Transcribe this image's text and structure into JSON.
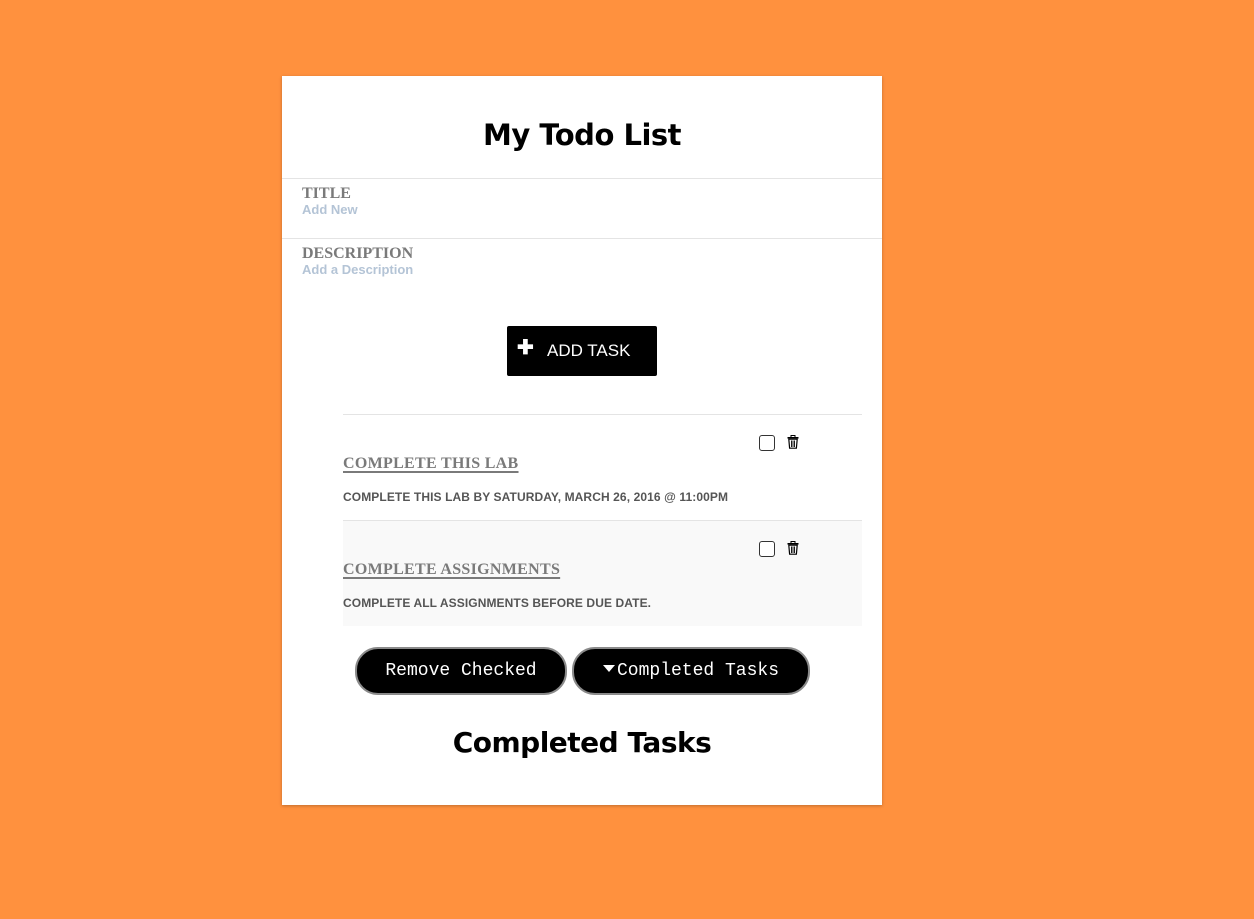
{
  "app": {
    "title": "My Todo List"
  },
  "form": {
    "title_label": "TITLE",
    "title_placeholder": "Add New",
    "description_label": "DESCRIPTION",
    "description_placeholder": "Add a Description",
    "add_button_label": "ADD TASK",
    "add_icon": "plus-icon"
  },
  "tasks": [
    {
      "title": "COMPLETE THIS LAB",
      "description": "COMPLETE THIS LAB BY SATURDAY, MARCH 26, 2016 @ 11:00PM",
      "checked": false
    },
    {
      "title": "COMPLETE ASSIGNMENTS",
      "description": "COMPLETE ALL ASSIGNMENTS BEFORE DUE DATE.",
      "checked": false
    }
  ],
  "actions": {
    "remove_checked_label": "Remove Checked",
    "completed_toggle_label": "Completed Tasks",
    "completed_toggle_icon": "caret-down-icon"
  },
  "completed_section": {
    "title": "Completed Tasks"
  },
  "colors": {
    "background": "#ff913e",
    "card": "#ffffff",
    "button": "#000000",
    "label_gray": "#7a7a7a",
    "placeholder": "#b4c4d6"
  }
}
